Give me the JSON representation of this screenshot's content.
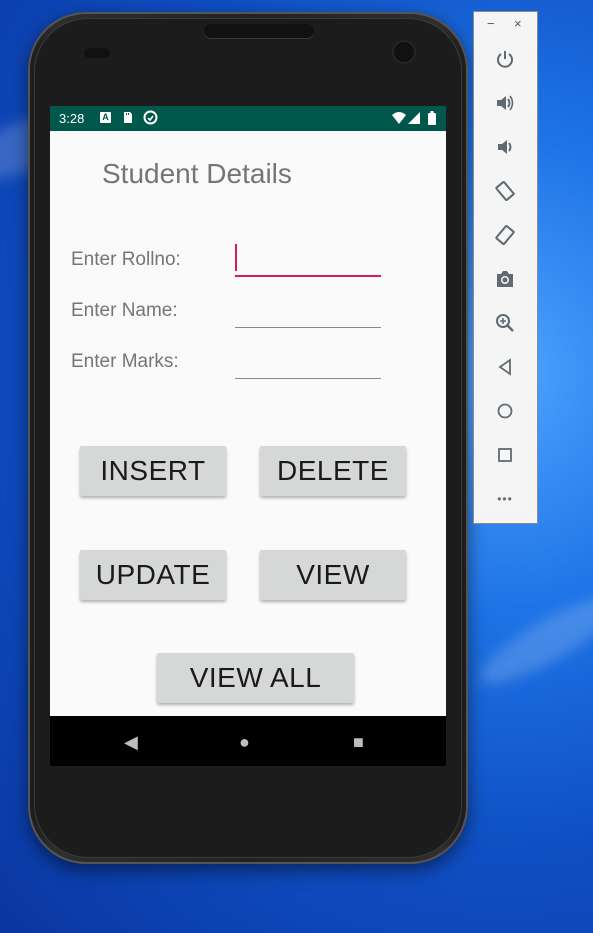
{
  "status_bar": {
    "time": "3:28"
  },
  "app": {
    "title": "Student Details",
    "fields": [
      {
        "label": "Enter Rollno:",
        "value": ""
      },
      {
        "label": "Enter Name:",
        "value": ""
      },
      {
        "label": "Enter Marks:",
        "value": ""
      }
    ],
    "buttons": {
      "insert": "INSERT",
      "delete": "DELETE",
      "update": "UPDATE",
      "view": "VIEW",
      "view_all": "VIEW ALL"
    }
  },
  "nav_bar": {
    "back": "◀",
    "home": "●",
    "recents": "■"
  },
  "emulator_toolbar": {
    "minimize": "−",
    "close": "×",
    "more": "•••",
    "icons": [
      "power-icon",
      "volume-up-icon",
      "volume-down-icon",
      "rotate-left-icon",
      "rotate-right-icon",
      "camera-icon",
      "zoom-icon",
      "back-icon",
      "home-icon",
      "overview-icon",
      "more-icon"
    ]
  },
  "colors": {
    "status_bar": "#00574b",
    "accent": "#d81b60",
    "button_bg": "#d6d7d7",
    "app_bg": "#fafafa"
  }
}
